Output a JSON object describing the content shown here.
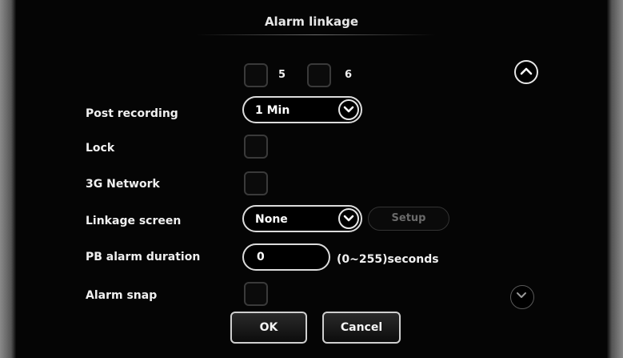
{
  "dialog": {
    "title": "Alarm linkage"
  },
  "channels": [
    {
      "label": "5",
      "checked": false
    },
    {
      "label": "6",
      "checked": false
    }
  ],
  "fields": {
    "post_recording": {
      "label": "Post recording",
      "value": "1 Min"
    },
    "lock": {
      "label": "Lock",
      "checked": false
    },
    "network_3g": {
      "label": "3G Network",
      "checked": false
    },
    "linkage_screen": {
      "label": "Linkage screen",
      "value": "None",
      "setup_label": "Setup",
      "setup_enabled": false
    },
    "pb_alarm_duration": {
      "label": "PB alarm duration",
      "value": "0",
      "range_hint": "(0~255)seconds"
    },
    "alarm_snap": {
      "label": "Alarm snap",
      "checked": false
    }
  },
  "scroll": {
    "up_icon": "chevron-up-icon",
    "down_icon": "chevron-down-icon"
  },
  "buttons": {
    "ok_label": "OK",
    "cancel_label": "Cancel"
  },
  "colors": {
    "background": "#050505",
    "text": "#f0f0f0",
    "border": "#dcdcdc",
    "disabled_text": "#6a6a6a"
  }
}
